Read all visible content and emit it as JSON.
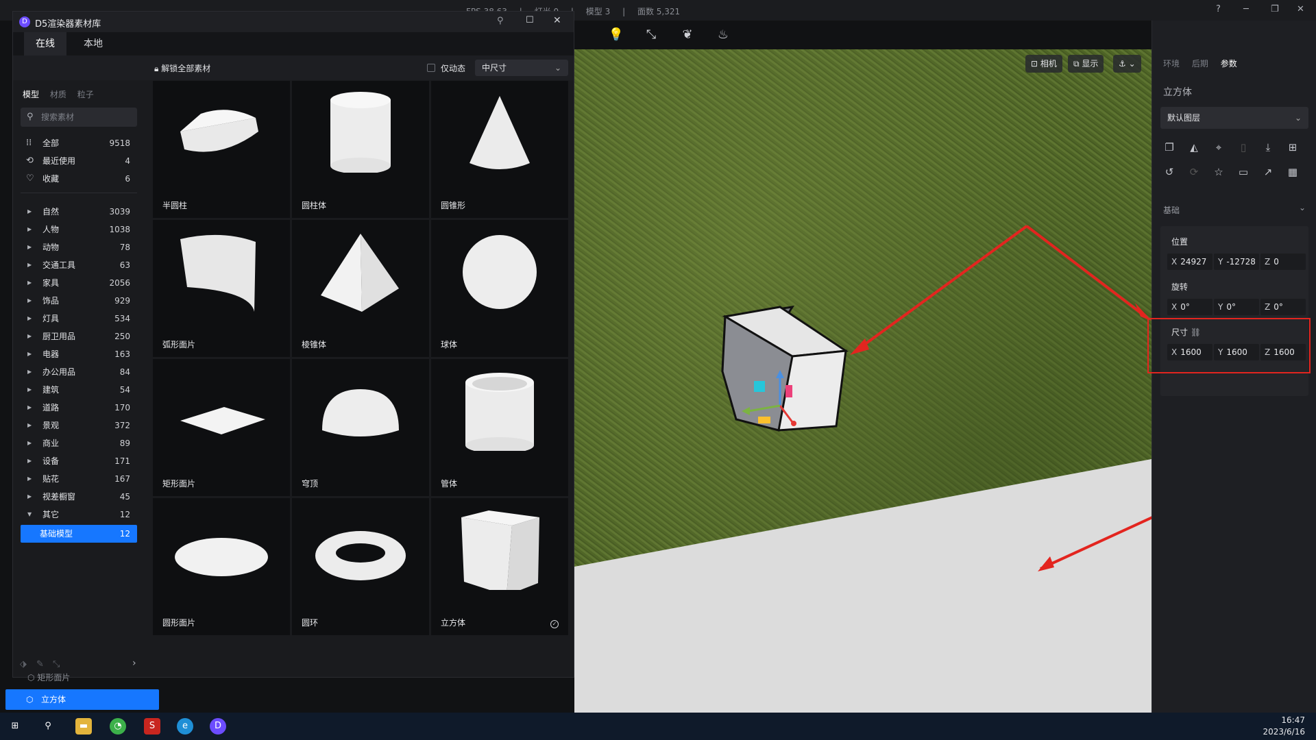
{
  "topbar": {
    "stats": [
      "FPS 38.63",
      "|",
      "灯光 0",
      "|",
      "模型 3",
      "|",
      "面数 5,321"
    ]
  },
  "viewport_toolbar": {
    "camera_label": "相机",
    "display_label": "显示"
  },
  "right_panel": {
    "tabs": [
      "环境",
      "后期",
      "参数"
    ],
    "active_tab": "参数",
    "object_title": "立方体",
    "layer": "默认图层",
    "section_basic": "基础",
    "position": {
      "label": "位置",
      "x": "24927",
      "y": "-12728",
      "z": "0"
    },
    "rotation": {
      "label": "旋转",
      "x": "0°",
      "y": "0°",
      "z": "0°"
    },
    "size": {
      "label": "尺寸",
      "x": "1600",
      "y": "1600",
      "z": "1600"
    },
    "axis_x": "X",
    "axis_y": "Y",
    "axis_z": "Z"
  },
  "library": {
    "title": "D5渲染器素材库",
    "tabs": [
      "在线",
      "本地"
    ],
    "unlock": "解锁全部素材",
    "dynamic_only": "仅动态",
    "size_option": "中尺寸",
    "side_tabs": [
      "模型",
      "材质",
      "粒子"
    ],
    "search_placeholder": "搜索素材",
    "quick": [
      {
        "label": "全部",
        "count": "9518"
      },
      {
        "label": "最近使用",
        "count": "4"
      },
      {
        "label": "收藏",
        "count": "6"
      }
    ],
    "categories": [
      {
        "label": "自然",
        "count": "3039"
      },
      {
        "label": "人物",
        "count": "1038"
      },
      {
        "label": "动物",
        "count": "78"
      },
      {
        "label": "交通工具",
        "count": "63"
      },
      {
        "label": "家具",
        "count": "2056"
      },
      {
        "label": "饰品",
        "count": "929"
      },
      {
        "label": "灯具",
        "count": "534"
      },
      {
        "label": "厨卫用品",
        "count": "250"
      },
      {
        "label": "电器",
        "count": "163"
      },
      {
        "label": "办公用品",
        "count": "84"
      },
      {
        "label": "建筑",
        "count": "54"
      },
      {
        "label": "道路",
        "count": "170"
      },
      {
        "label": "景观",
        "count": "372"
      },
      {
        "label": "商业",
        "count": "89"
      },
      {
        "label": "设备",
        "count": "171"
      },
      {
        "label": "贴花",
        "count": "167"
      },
      {
        "label": "视差橱窗",
        "count": "45"
      },
      {
        "label": "其它",
        "count": "12"
      }
    ],
    "selected_sub": {
      "label": "基础模型",
      "count": "12"
    },
    "items": [
      "半圆柱",
      "圆柱体",
      "圆锥形",
      "弧形面片",
      "棱锥体",
      "球体",
      "矩形面片",
      "穹顶",
      "管体",
      "圆形面片",
      "圆环",
      "立方体"
    ]
  },
  "scene_list": {
    "partial_item": "矩形面片",
    "selected_item": "立方体"
  },
  "clock": {
    "time": "16:47",
    "date": "2023/6/16"
  }
}
